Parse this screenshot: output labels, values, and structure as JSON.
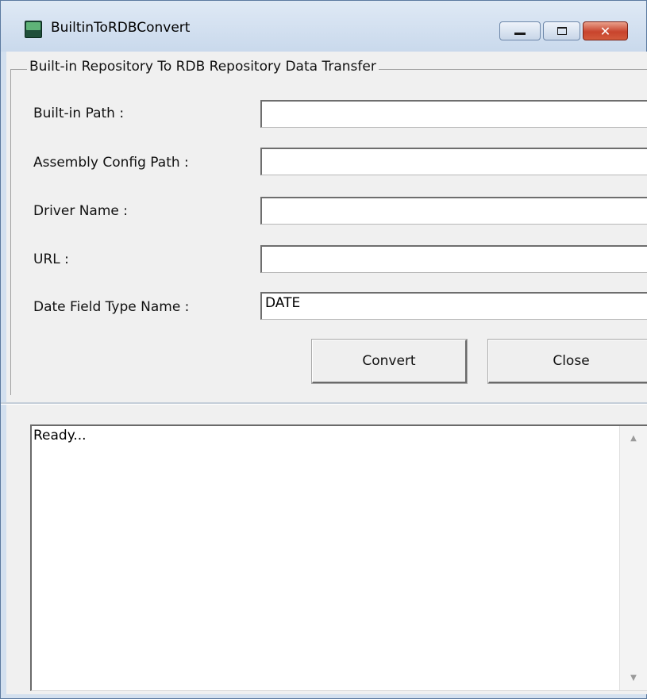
{
  "window": {
    "title": "BuiltinToRDBConvert",
    "icon": "app-icon",
    "controls": {
      "minimize": "minimize-icon",
      "maximize": "maximize-icon",
      "close_glyph": "✕"
    },
    "accent_colors": {
      "close_button": "#c8442d",
      "titlebar": "#d3e0ef"
    }
  },
  "form": {
    "group_title": "Built-in Repository To RDB Repository Data Transfer",
    "fields": [
      {
        "label": "Built-in Path :",
        "value": ""
      },
      {
        "label": "Assembly Config Path :",
        "value": ""
      },
      {
        "label": "Driver Name :",
        "value": ""
      },
      {
        "label": "URL :",
        "value": ""
      },
      {
        "label": "Date Field Type Name :",
        "value": "DATE"
      }
    ],
    "convert_label": "Convert",
    "close_label": "Close"
  },
  "log": {
    "text": "Ready...",
    "scroll_up": "▲",
    "scroll_down": "▼"
  }
}
